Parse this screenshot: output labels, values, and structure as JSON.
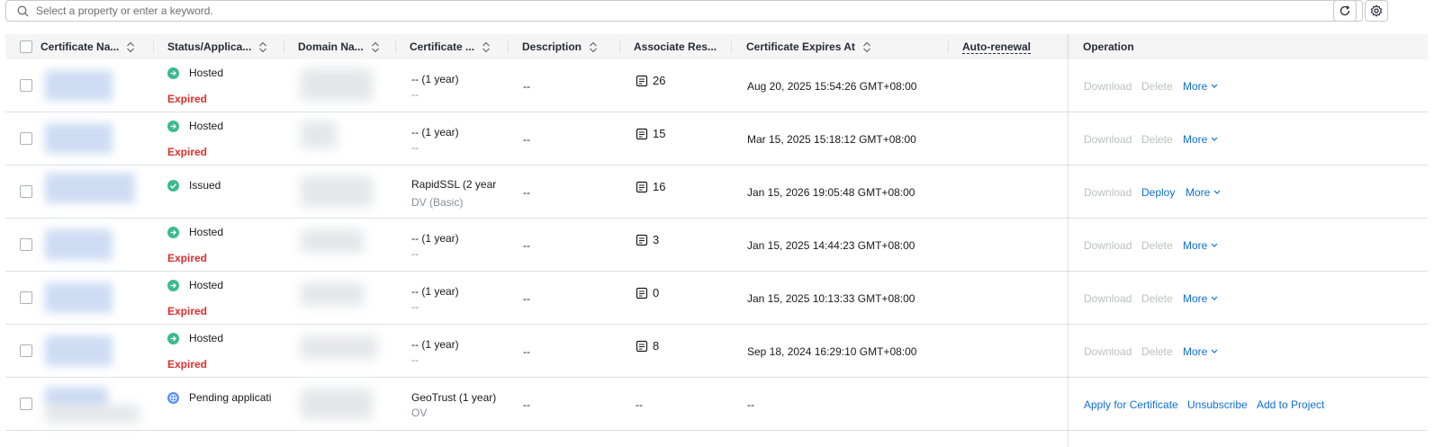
{
  "search": {
    "placeholder": "Select a property or enter a keyword."
  },
  "toolbar": {
    "refresh_icon": "refresh-icon",
    "settings_icon": "gear-icon"
  },
  "columns": {
    "name": "Certificate Na...",
    "status": "Status/Applica...",
    "domain": "Domain Na...",
    "certificate": "Certificate ...",
    "description": "Description",
    "associated": "Associate Res...",
    "expires": "Certificate Expires At",
    "auto_renewal": "Auto-renewal",
    "operation": "Operation"
  },
  "colors": {
    "link": "#0e6fd9",
    "expired": "#e02e2e",
    "hosted": "#3cbb8c",
    "pending": "#5b8ff9"
  },
  "rows": [
    {
      "status": "Hosted",
      "status_icon": "arrow-right-circle-icon",
      "substatus": "Expired",
      "cert_line1": "-- (1 year)",
      "cert_line2": "--",
      "description": "--",
      "resources": "26",
      "expires": "Aug 20, 2025 15:54:26 GMT+08:00",
      "op1": "Download",
      "op2": "Delete",
      "op3": "More"
    },
    {
      "status": "Hosted",
      "status_icon": "arrow-right-circle-icon",
      "substatus": "Expired",
      "cert_line1": "-- (1 year)",
      "cert_line2": "--",
      "description": "--",
      "resources": "15",
      "expires": "Mar 15, 2025 15:18:12 GMT+08:00",
      "op1": "Download",
      "op2": "Delete",
      "op3": "More"
    },
    {
      "status": "Issued",
      "status_icon": "check-circle-icon",
      "substatus": "",
      "cert_line1": "RapidSSL (2 year",
      "cert_line2": "DV (Basic)",
      "description": "--",
      "resources": "16",
      "expires": "Jan 15, 2026 19:05:48 GMT+08:00",
      "op1": "Download",
      "op2": "Deploy",
      "op3": "More"
    },
    {
      "status": "Hosted",
      "status_icon": "arrow-right-circle-icon",
      "substatus": "Expired",
      "cert_line1": "-- (1 year)",
      "cert_line2": "--",
      "description": "--",
      "resources": "3",
      "expires": "Jan 15, 2025 14:44:23 GMT+08:00",
      "op1": "Download",
      "op2": "Delete",
      "op3": "More"
    },
    {
      "status": "Hosted",
      "status_icon": "arrow-right-circle-icon",
      "substatus": "Expired",
      "cert_line1": "-- (1 year)",
      "cert_line2": "--",
      "description": "--",
      "resources": "0",
      "expires": "Jan 15, 2025 10:13:33 GMT+08:00",
      "op1": "Download",
      "op2": "Delete",
      "op3": "More"
    },
    {
      "status": "Hosted",
      "status_icon": "arrow-right-circle-icon",
      "substatus": "Expired",
      "cert_line1": "-- (1 year)",
      "cert_line2": "--",
      "description": "--",
      "resources": "8",
      "expires": "Sep 18, 2024 16:29:10 GMT+08:00",
      "op1": "Download",
      "op2": "Delete",
      "op3": "More"
    },
    {
      "status": "Pending applicati",
      "status_icon": "pending-globe-icon",
      "substatus": "",
      "cert_line1": "GeoTrust (1 year)",
      "cert_line2": "OV",
      "description": "--",
      "resources": "--",
      "expires": "--",
      "op1": "Apply for Certificate",
      "op2": "Unsubscribe",
      "op3": "Add to Project"
    }
  ]
}
